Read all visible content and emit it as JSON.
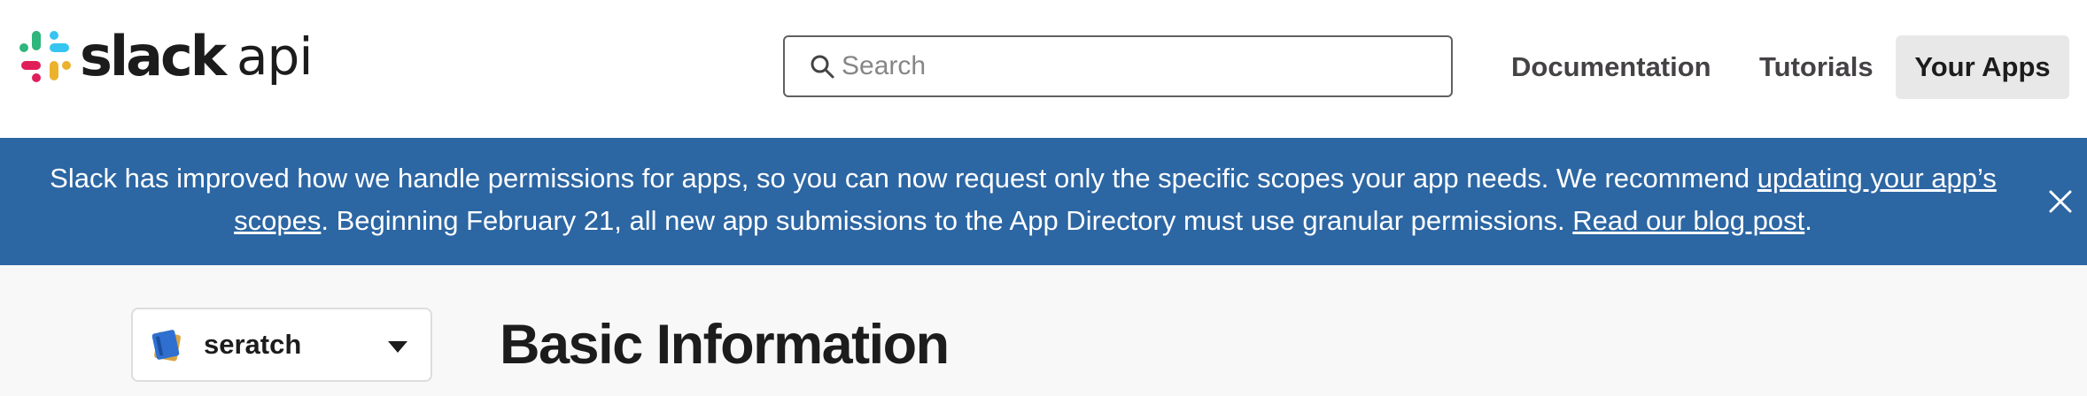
{
  "header": {
    "logo": {
      "wordmark": "slack",
      "suffix": "api"
    },
    "search": {
      "placeholder": "Search",
      "value": ""
    },
    "nav": [
      {
        "label": "Documentation"
      },
      {
        "label": "Tutorials"
      },
      {
        "label": "Your Apps",
        "active": true
      }
    ]
  },
  "banner": {
    "text_1": "Slack has improved how we handle permissions for apps, so you can now request only the specific scopes your app needs. We recommend ",
    "link_1": "updating your app’s scopes",
    "text_2": ". Beginning February 21, all new app submissions to the App Directory must use granular permissions. ",
    "link_2": "Read our blog post",
    "text_3": "."
  },
  "app_selector": {
    "name": "seratch",
    "icon": "blue-notebook-icon"
  },
  "page": {
    "title": "Basic Information"
  },
  "colors": {
    "banner_bg": "#2c66a3",
    "header_bg": "#ffffff",
    "page_bg": "#f8f8f8",
    "active_nav_bg": "#e8e8e8",
    "text": "#1d1c1d"
  },
  "icons": {
    "search": "search-icon",
    "close": "close-icon",
    "caret": "caret-down-icon",
    "logo": "slack-logo-icon"
  }
}
